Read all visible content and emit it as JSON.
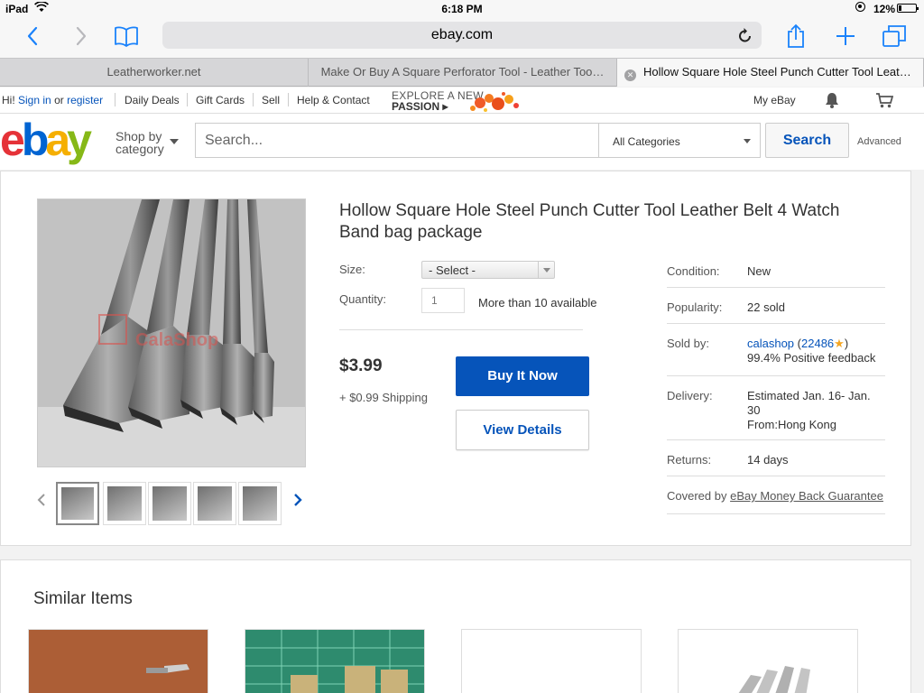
{
  "status_bar": {
    "device": "iPad",
    "time": "6:18 PM",
    "battery": "12%"
  },
  "browser": {
    "url": "ebay.com",
    "tabs": [
      {
        "title": "Leatherworker.net"
      },
      {
        "title": "Make Or Buy A Square Perforator Tool - Leather Too…"
      },
      {
        "title": "Hollow Square Hole Steel Punch Cutter Tool Leat…"
      }
    ]
  },
  "topnav": {
    "greeting_prefix": "Hi!",
    "sign_in": "Sign in",
    "or": "or",
    "register": "register",
    "links": [
      "Daily Deals",
      "Gift Cards",
      "Sell",
      "Help & Contact"
    ],
    "promo_line1": "EXPLORE A NEW",
    "promo_line2": "PASSION",
    "my_ebay": "My eBay"
  },
  "header": {
    "logo_letters": [
      "e",
      "b",
      "a",
      "y"
    ],
    "shop_by_line1": "Shop by",
    "shop_by_line2": "category",
    "search_placeholder": "Search...",
    "category": "All Categories",
    "search_button": "Search",
    "advanced": "Advanced"
  },
  "product": {
    "title": "Hollow Square Hole Steel Punch Cutter Tool Leather Belt 4 Watch Band bag package",
    "watermark": "CalaShop",
    "size_label": "Size:",
    "size_value": "- Select -",
    "quantity_label": "Quantity:",
    "quantity_placeholder": "1",
    "availability": "More than 10 available",
    "price": "$3.99",
    "shipping": "+ $0.99 Shipping",
    "buy_now": "Buy It Now",
    "view_details": "View Details",
    "thumbnail_count": 5
  },
  "details": {
    "condition_label": "Condition:",
    "condition": "New",
    "popularity_label": "Popularity:",
    "popularity": "22 sold",
    "sold_by_label": "Sold by:",
    "seller": "calashop",
    "seller_score_open": "(",
    "seller_score": "22486",
    "seller_score_close": ")",
    "feedback": "99.4% Positive feedback",
    "delivery_label": "Delivery:",
    "delivery_line1": "Estimated Jan. 16- Jan.",
    "delivery_line2": "30",
    "delivery_line3": "From:Hong Kong",
    "returns_label": "Returns:",
    "returns": "14 days",
    "covered_by": "Covered by",
    "guarantee": "eBay Money Back Guarantee"
  },
  "similar": {
    "title": "Similar Items"
  },
  "colors": {
    "ebay_red": "#e53238",
    "ebay_blue": "#0064d2",
    "ebay_yellow": "#f5af02",
    "ebay_green": "#86b817",
    "link_blue": "#0654ba",
    "ios_blue": "#1a82fb"
  }
}
